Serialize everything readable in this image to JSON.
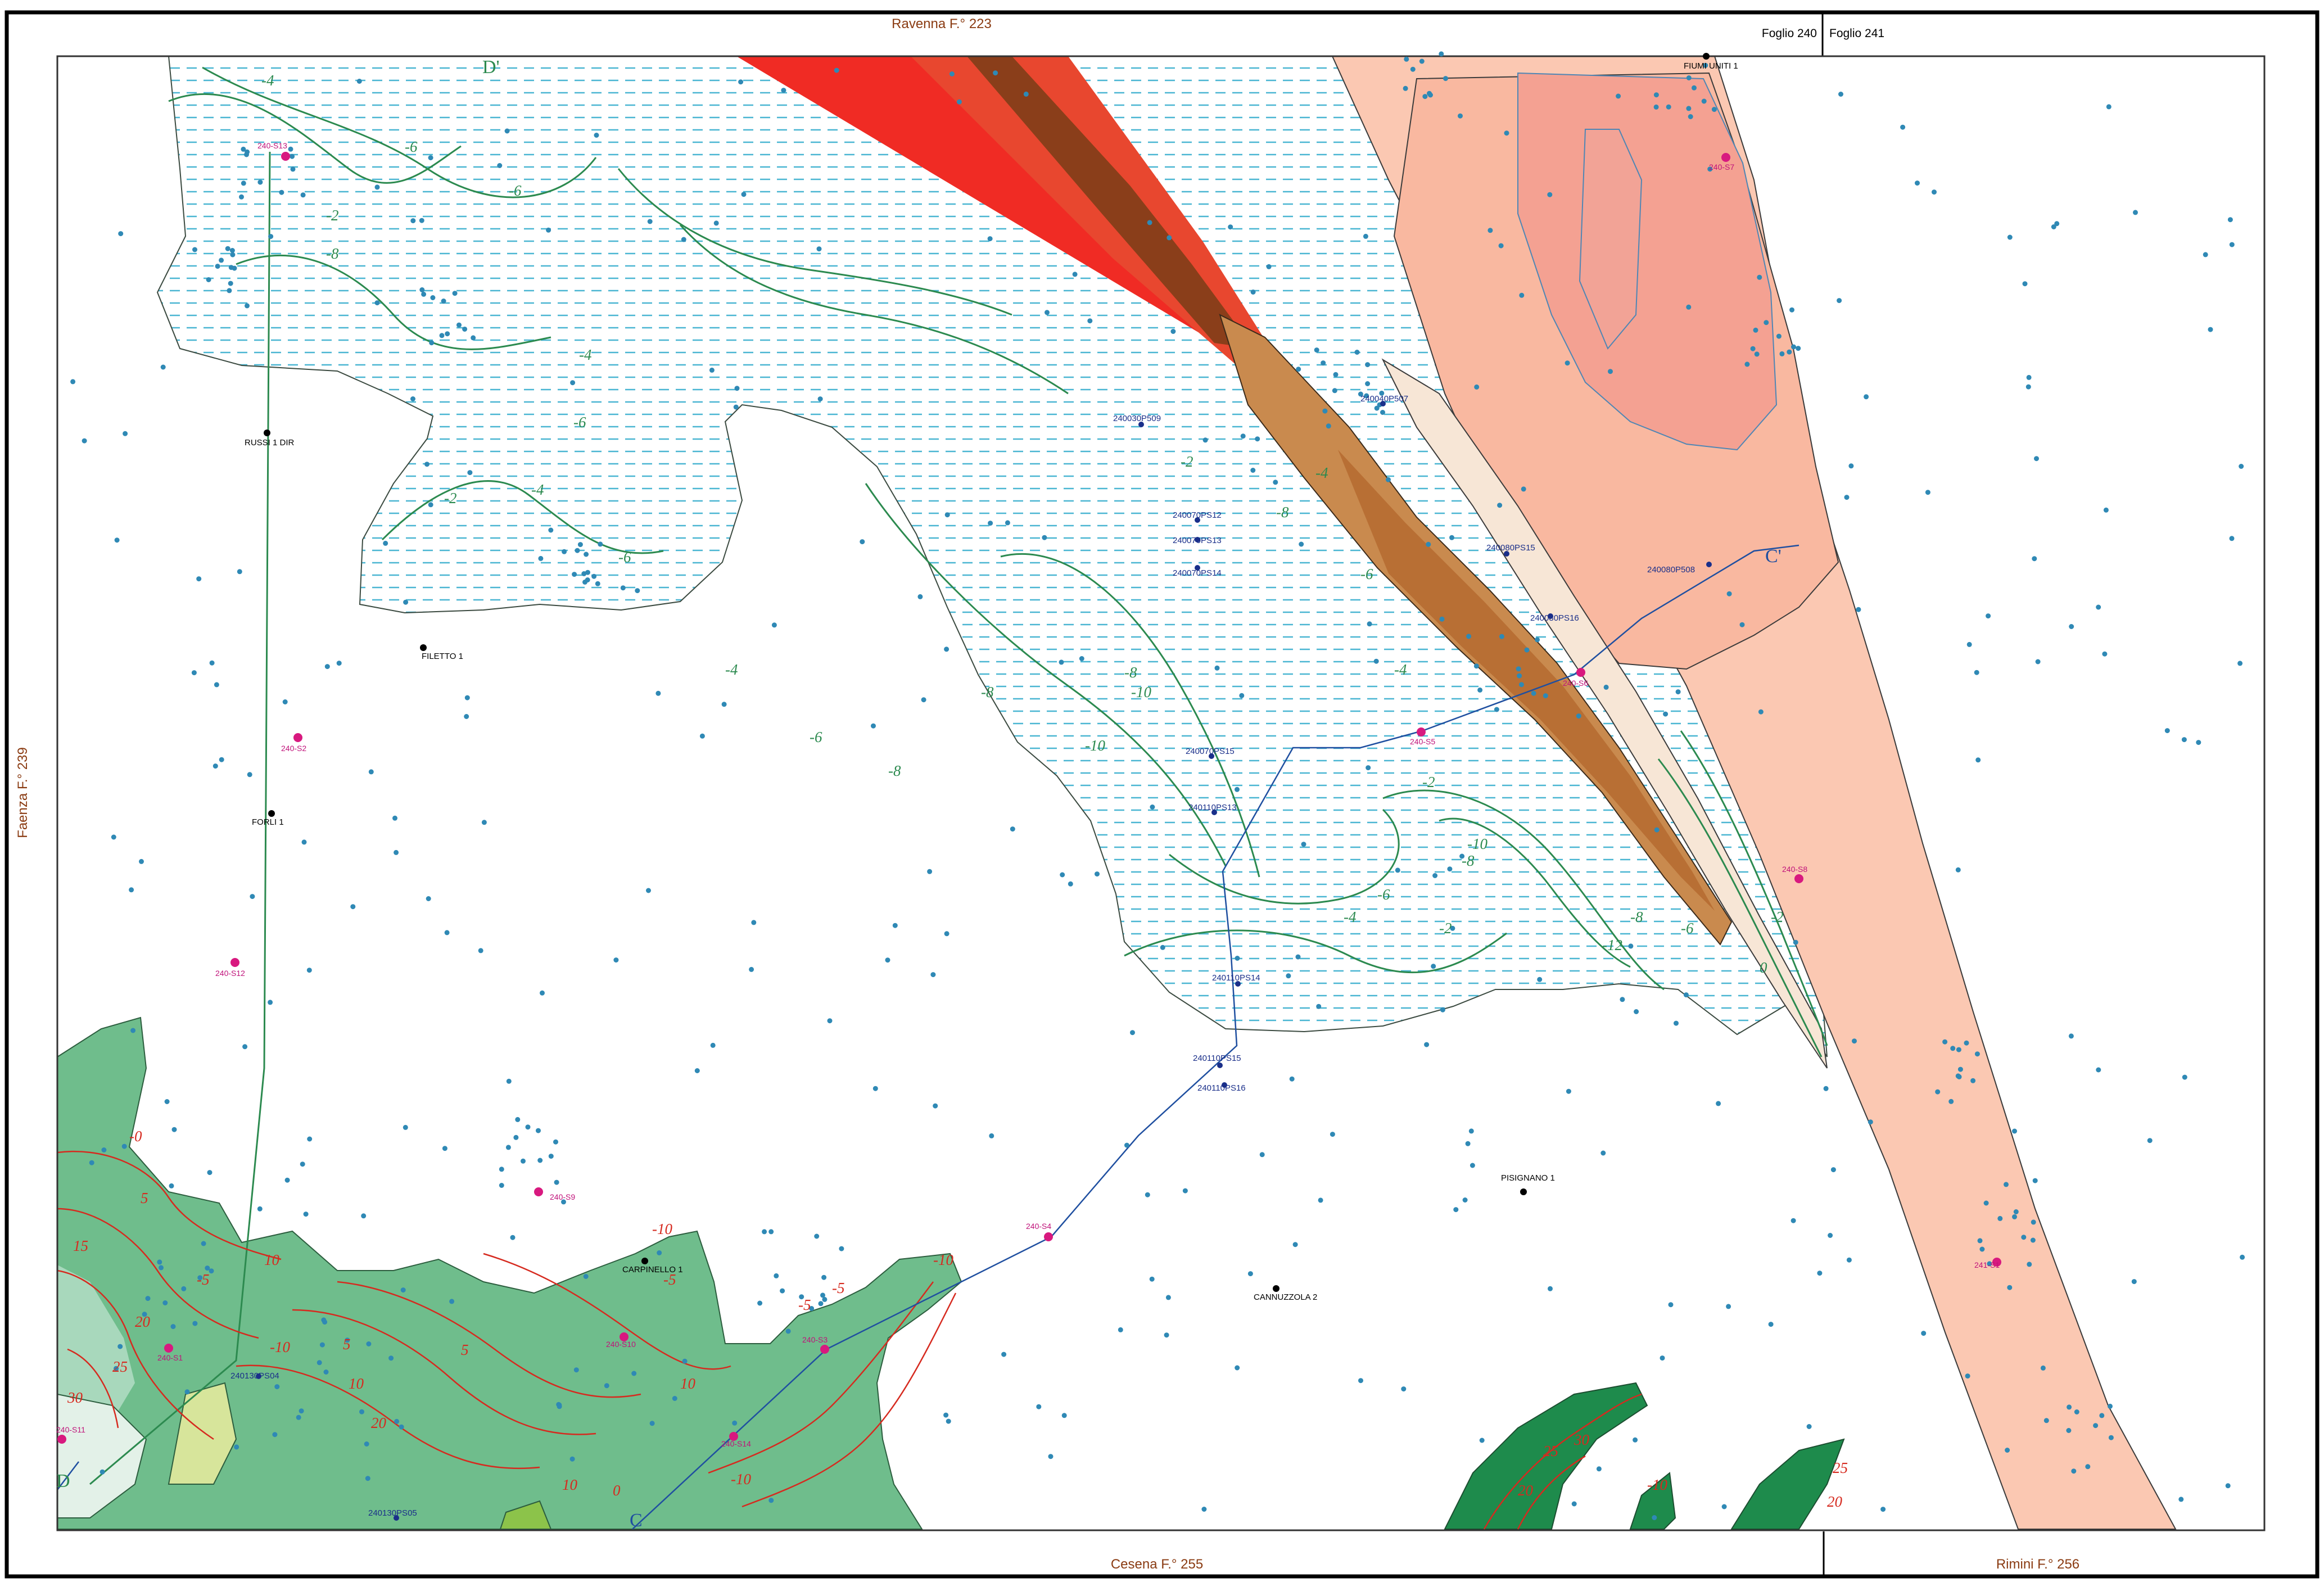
{
  "sheets": {
    "north": "Ravenna F.° 223",
    "west": "Faenza F.° 239",
    "south_main": "Cesena F.° 255",
    "south_right": "Rimini F.° 256",
    "foglio_left": "Foglio 240",
    "foglio_right": "Foglio 241"
  },
  "colors": {
    "frame": "#000000",
    "hatch_dash": "#4ab6d2",
    "shallow_contour": "#2c8a4f",
    "deep_contour": "#d62a1f",
    "section_line": "#1f4fa0",
    "borehole": "#d8197f",
    "scatter_point": "#2f89b5",
    "well": "#000000"
  },
  "deep_wells": [
    {
      "name": "RUSSI 1 DIR"
    },
    {
      "name": "FILETTO 1"
    },
    {
      "name": "FORLI 1"
    },
    {
      "name": "CARPINELLO 1"
    },
    {
      "name": "CANNUZZOLA 2"
    },
    {
      "name": "PISIGNANO 1"
    },
    {
      "name": "FIUMI UNITI 1"
    }
  ],
  "boreholes": [
    {
      "name": "240-S13"
    },
    {
      "name": "240-S2"
    },
    {
      "name": "240-S12"
    },
    {
      "name": "240-S9"
    },
    {
      "name": "240-S1"
    },
    {
      "name": "240-S11"
    },
    {
      "name": "240-S10"
    },
    {
      "name": "240-S3"
    },
    {
      "name": "240-S14"
    },
    {
      "name": "240-S4"
    },
    {
      "name": "240-S5"
    },
    {
      "name": "240-S6"
    },
    {
      "name": "240-S7"
    },
    {
      "name": "240-S8"
    },
    {
      "name": "241-S1"
    }
  ],
  "penetrometer_points": [
    {
      "name": "240030P509"
    },
    {
      "name": "240040P507"
    },
    {
      "name": "240070PS12"
    },
    {
      "name": "240070PS13"
    },
    {
      "name": "240070PS14"
    },
    {
      "name": "240070PS15"
    },
    {
      "name": "240080PS15"
    },
    {
      "name": "240080P508"
    },
    {
      "name": "240080PS16"
    },
    {
      "name": "240110PS13"
    },
    {
      "name": "240110PS14"
    },
    {
      "name": "240110PS15"
    },
    {
      "name": "240110PS16"
    },
    {
      "name": "240130PS04"
    },
    {
      "name": "240130PS05"
    }
  ],
  "sections": [
    {
      "start": "C",
      "end": "C'"
    },
    {
      "start": "D",
      "end": "D'"
    }
  ],
  "contour_labels": {
    "shallow": [
      "-4",
      "-8",
      "-2",
      "-6",
      "-6",
      "-4",
      "-2",
      "-6",
      "-4",
      "-6",
      "-8",
      "-10",
      "-8",
      "-10",
      "-8",
      "-6",
      "-4",
      "-8",
      "-6",
      "-4",
      "-2",
      "-4",
      "-2",
      "-6",
      "-8",
      "-4",
      "-2",
      "0",
      "-2",
      "-6",
      "-8",
      "-10",
      "-12"
    ],
    "deep": [
      "-0",
      "5",
      "10",
      "15",
      "20",
      "25",
      "30",
      "-5",
      "-10",
      "5",
      "10",
      "20",
      "10",
      "5",
      "-5",
      "-10",
      "0",
      "-5",
      "-10",
      "-5",
      "30",
      "25",
      "20",
      "20",
      "25",
      "-10",
      "10",
      "-10"
    ]
  },
  "map_extent": {
    "lon_range": [
      0,
      1
    ],
    "lat_range": [
      0,
      1
    ]
  }
}
